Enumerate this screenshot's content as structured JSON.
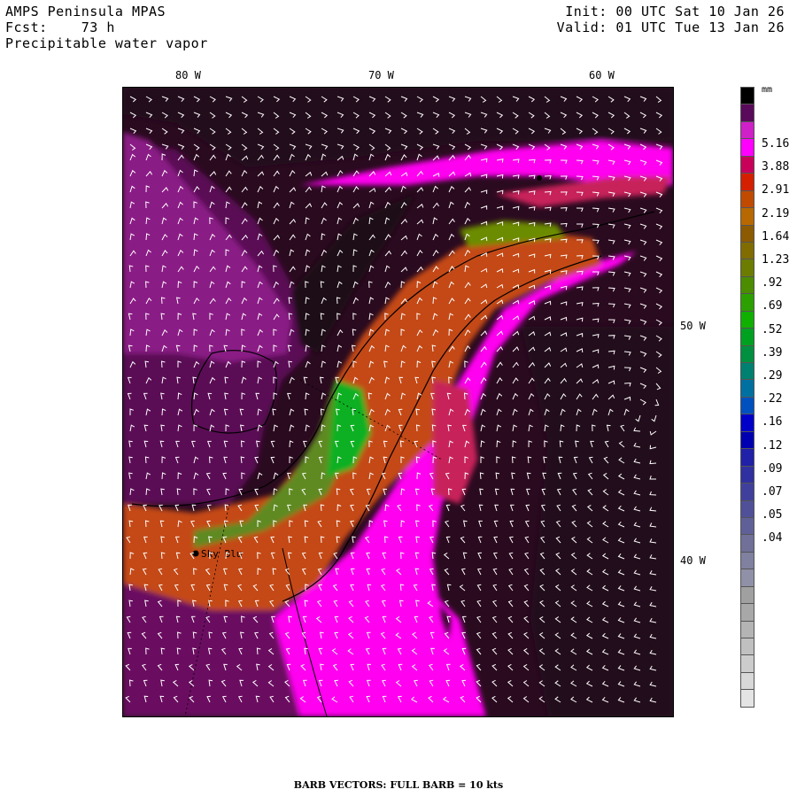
{
  "header": {
    "model": "AMPS Peninsula MPAS",
    "forecast_line": "Fcst:    73 h",
    "field": "Precipitable water vapor",
    "init": "Init: 00 UTC Sat 10 Jan 26",
    "valid": "Valid: 01 UTC Tue 13 Jan 26"
  },
  "map": {
    "top_longitude_labels": [
      "80 W",
      "70 W",
      "60 W"
    ],
    "right_longitude_labels": [
      "50 W",
      "40 W"
    ],
    "station_label": "Sky Blu"
  },
  "legend": {
    "unit": "mm",
    "labels": [
      "5.16",
      "3.88",
      "2.91",
      "2.19",
      "1.64",
      "1.23",
      ".92",
      ".69",
      ".52",
      ".39",
      ".29",
      ".22",
      ".16",
      ".12",
      ".09",
      ".07",
      ".05",
      ".04"
    ],
    "colors": [
      "#000000",
      "#5a0a5a",
      "#d020c8",
      "#ff00ff",
      "#c8005a",
      "#d42000",
      "#c04a00",
      "#b86800",
      "#8c5a00",
      "#806c00",
      "#6c7c00",
      "#4c8c00",
      "#2ca000",
      "#10b000",
      "#00a020",
      "#009040",
      "#008070",
      "#0070a0",
      "#0050c0",
      "#0000c8",
      "#0000b0",
      "#2020a8",
      "#3030a0",
      "#40409c",
      "#505098",
      "#606098",
      "#707098",
      "#8080a0",
      "#9090a8",
      "#a0a0a0",
      "#a8a8a8",
      "#b4b4b4",
      "#c0c0c0",
      "#cccccc",
      "#d8d8d8",
      "#e4e4e4"
    ]
  },
  "footer": "BARB VECTORS:  FULL BARB = 10 kts"
}
